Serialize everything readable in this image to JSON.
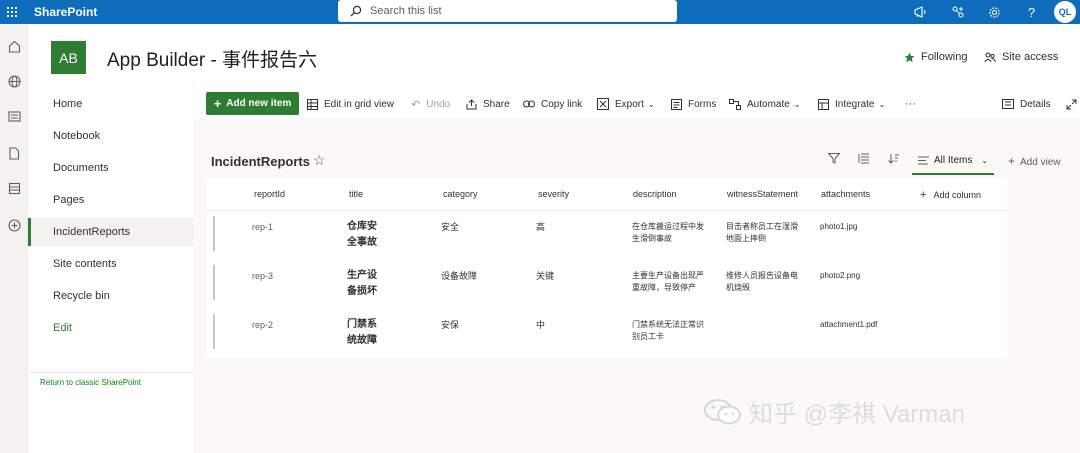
{
  "app": {
    "brand": "SharePoint",
    "user_initials": "QL"
  },
  "search": {
    "placeholder": "Search this list"
  },
  "site": {
    "logo_initials": "AB",
    "title": "App Builder - 事件报告六",
    "following": "Following",
    "site_access": "Site access"
  },
  "nav": {
    "items": [
      "Home",
      "Notebook",
      "Documents",
      "Pages",
      "IncidentReports",
      "Site contents",
      "Recycle bin",
      "Edit"
    ],
    "selected": "IncidentReports",
    "return_link": "Return to classic SharePoint"
  },
  "commands": {
    "add_new": "Add new item",
    "edit_grid": "Edit in grid view",
    "undo": "Undo",
    "share": "Share",
    "copy_link": "Copy link",
    "export": "Export",
    "forms": "Forms",
    "automate": "Automate",
    "integrate": "Integrate",
    "more": "···",
    "details": "Details"
  },
  "list": {
    "title": "IncidentReports",
    "view_name": "All Items",
    "add_view": "Add view",
    "columns": [
      "reportId",
      "title",
      "category",
      "severity",
      "description",
      "witnessStatement",
      "attachments"
    ],
    "add_column": "Add column",
    "rows": [
      {
        "reportId": "rep-1",
        "title_1": "仓库安",
        "title_2": "全事故",
        "category": "安全",
        "severity": "高",
        "description_1": "在仓库搬运过程中发",
        "description_2": "生滑倒事故",
        "witness_1": "目击者称员工在湿滑",
        "witness_2": "地面上摔倒",
        "attachments": "photo1.jpg"
      },
      {
        "reportId": "rep-3",
        "title_1": "生产设",
        "title_2": "备损坏",
        "category": "设备故障",
        "severity": "关键",
        "description_1": "主要生产设备出现严",
        "description_2": "重故障，导致停产",
        "witness_1": "维修人员报告设备电",
        "witness_2": "机烧毁",
        "attachments": "photo2.png"
      },
      {
        "reportId": "rep-2",
        "title_1": "门禁系",
        "title_2": "统故障",
        "category": "安保",
        "severity": "中",
        "description_1": "门禁系统无法正常识",
        "description_2": "别员工卡",
        "witness_1": "",
        "witness_2": "",
        "attachments": "attachment1.pdf"
      }
    ]
  },
  "watermark": {
    "text": "知乎 @李祺 Varman"
  },
  "colors": {
    "suite_bar": "#0f6cbd",
    "accent": "#2e7d32"
  }
}
